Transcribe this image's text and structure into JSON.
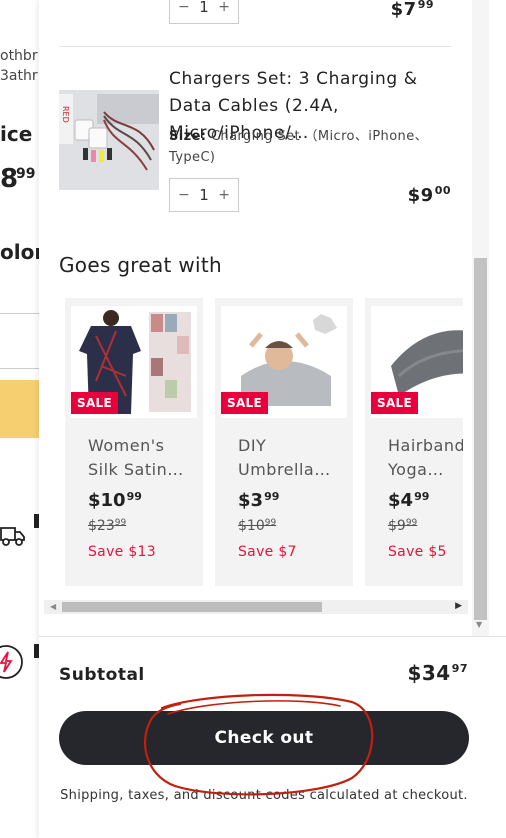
{
  "background_page": {
    "fragments": [
      "othbr",
      "3athr",
      "ice",
      "8",
      "99",
      "olor"
    ]
  },
  "cart": {
    "items": [
      {
        "quantity": "1",
        "price_main": "$7",
        "price_cents": "99"
      },
      {
        "title": "Chargers Set: 3 Charging & Data Cables (2.4A, Micro/iPhone/…",
        "size_label": "Size:",
        "size_value": "Charging Set （Micro、iPhone、TypeC)",
        "quantity": "1",
        "price_main": "$9",
        "price_cents": "00"
      }
    ],
    "stepper": {
      "minus": "−",
      "plus": "+"
    }
  },
  "recommendations": {
    "title": "Goes great with",
    "products": [
      {
        "badge": "SALE",
        "name": "Women's Silk Satin…",
        "price_main": "$10",
        "price_cents": "99",
        "compare_main": "$23",
        "compare_cents": "99",
        "savings": "Save $13"
      },
      {
        "badge": "SALE",
        "name": "DIY Umbrella…",
        "price_main": "$3",
        "price_cents": "99",
        "compare_main": "$10",
        "compare_cents": "99",
        "savings": "Save $7"
      },
      {
        "badge": "SALE",
        "name": "Hairband Yoga…",
        "price_main": "$4",
        "price_cents": "99",
        "compare_main": "$9",
        "compare_cents": "99",
        "savings": "Save $5"
      }
    ]
  },
  "footer": {
    "subtotal_label": "Subtotal",
    "subtotal_main": "$34",
    "subtotal_cents": "97",
    "checkout_label": "Check out",
    "note": "Shipping, taxes, and discount codes calculated at checkout."
  },
  "colors": {
    "checkout_bg": "#25272c",
    "sale_badge": "#e8003c",
    "savings_text": "#e0163e",
    "annotation": "#c0200f"
  }
}
